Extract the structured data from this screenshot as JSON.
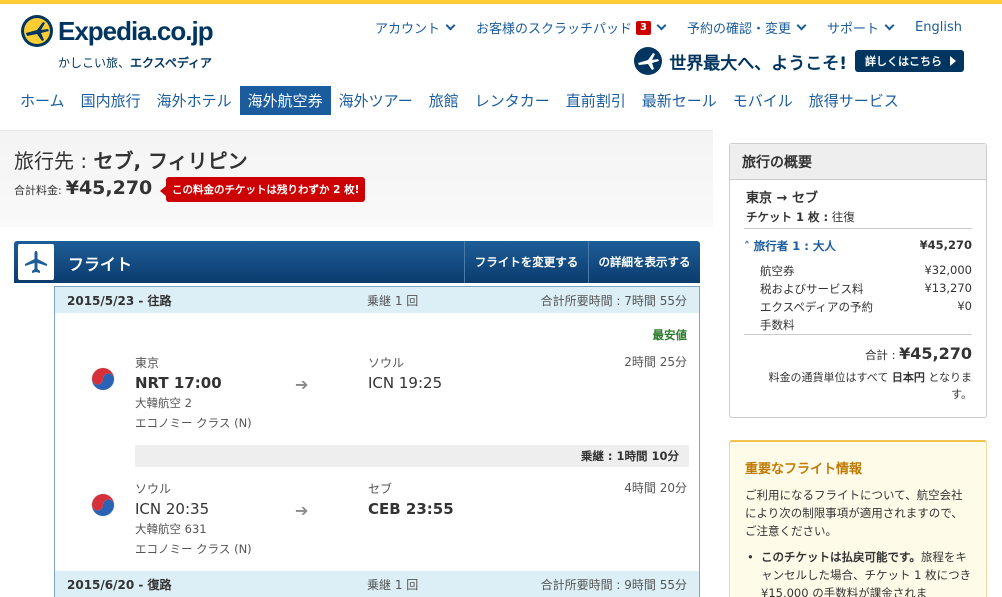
{
  "brand": {
    "logo_text": "Expedia.co.jp",
    "tagline_prefix": "かしこい旅、",
    "tagline_bold": "エクスペディア"
  },
  "util_nav": {
    "account": "アカウント",
    "scratchpad": "お客様のスクラッチパッド",
    "scratchpad_count": "3",
    "booking": "予約の確認・変更",
    "support": "サポート",
    "language": "English"
  },
  "promo": {
    "text": "世界最大へ、ようこそ!",
    "button": "詳しくはこちら"
  },
  "main_nav": [
    {
      "label": "ホーム"
    },
    {
      "label": "国内旅行"
    },
    {
      "label": "海外ホテル"
    },
    {
      "label": "海外航空券",
      "active": true
    },
    {
      "label": "海外ツアー"
    },
    {
      "label": "旅館"
    },
    {
      "label": "レンタカー"
    },
    {
      "label": "直前割引"
    },
    {
      "label": "最新セール"
    },
    {
      "label": "モバイル"
    },
    {
      "label": "旅得サービス"
    }
  ],
  "destination": {
    "prefix": "旅行先 : ",
    "name": "セブ, フィリピン",
    "total_label": "合計料金:",
    "total_value": "¥45,270",
    "warning": "この料金のチケットは残りわずか 2 枚!"
  },
  "flight_bar": {
    "title": "フライト",
    "change_button": "フライトを変更する",
    "details_button": "の詳細を表示する"
  },
  "outbound": {
    "date": "2015/5/23 - 往路",
    "stops": "乗継 1 回",
    "total_time": "合計所要時間 : 7時間 55分",
    "best_value": "最安値",
    "legs": [
      {
        "from_city": "東京",
        "from_time": "NRT 17:00",
        "to_city": "ソウル",
        "to_time": "ICN 19:25",
        "duration": "2時間 25分",
        "flight": "大韓航空 2",
        "cabin": "エコノミー クラス (N)"
      },
      {
        "from_city": "ソウル",
        "from_time": "ICN 20:35",
        "to_city": "セブ",
        "to_time": "CEB 23:55",
        "duration": "4時間 20分",
        "flight": "大韓航空 631",
        "cabin": "エコノミー クラス (N)"
      }
    ],
    "layover": "乗継 : 1時間 10分"
  },
  "return": {
    "date": "2015/6/20 - 復路",
    "stops": "乗継 1 回",
    "total_time": "合計所要時間 : 9時間 55分"
  },
  "summary": {
    "title": "旅行の概要",
    "route": "東京 → セブ",
    "ticket_bold": "チケット 1 枚 :",
    "ticket_type": " 往復",
    "traveler_label": "旅行者 1 : 大人",
    "traveler_amount": "¥45,270",
    "fees": [
      {
        "label": "航空券",
        "amount": "¥32,000"
      },
      {
        "label": "税およびサービス料",
        "amount": "¥13,270"
      },
      {
        "label": "エクスペディアの予約",
        "amount": "¥0"
      },
      {
        "label": "手数料",
        "amount": ""
      }
    ],
    "total_label": "合計 :",
    "total_value": "¥45,270",
    "note_prefix": "料金の通貨単位はすべて ",
    "note_currency": "日本円",
    "note_suffix": " となります。"
  },
  "notice": {
    "title": "重要なフライト情報",
    "body": "ご利用になるフライトについて、航空会社により次の制限事項が適用されますので、ご注意ください。",
    "bullet_bold": "このチケットは払戻可能です。",
    "bullet_text": "旅程をキャンセルした場合、チケット 1 枚につき ¥15,000 の手数料が課金されま"
  },
  "colors": {
    "brand_navy": "#00355f",
    "link_blue": "#1a5c9e",
    "warning_red": "#cc0000",
    "best_green": "#2a7a2a",
    "notice_title": "#c07a00"
  }
}
